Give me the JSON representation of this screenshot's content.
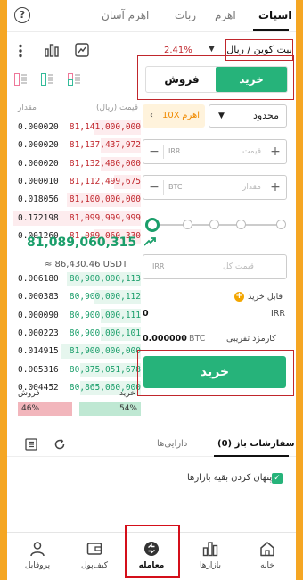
{
  "tabs": {
    "spot": "اسپات",
    "margin": "اهرم",
    "bot": "ربات",
    "easy_margin": "اهرم آسان"
  },
  "pair": {
    "name": "بیت کوین / ریال",
    "change": "2.41%"
  },
  "trade": {
    "buy_label": "خرید",
    "sell_label": "فروش",
    "order_type": "محدود",
    "leverage_label": "اهرم",
    "leverage_value": "10X"
  },
  "book": {
    "price_header": "قیمت (ریال)",
    "amount_header": "مقدار",
    "asks": [
      {
        "amount": "0.000020",
        "price": "81,141,000,000",
        "depth": 0.35
      },
      {
        "amount": "0.000020",
        "price": "81,137,437,972",
        "depth": 0.3
      },
      {
        "amount": "0.000020",
        "price": "81,132,480,000",
        "depth": 0.3
      },
      {
        "amount": "0.000010",
        "price": "81,112,499,675",
        "depth": 0.2
      },
      {
        "amount": "0.018056",
        "price": "81,100,000,000",
        "depth": 0.55
      },
      {
        "amount": "0.172198",
        "price": "81,099,999,999",
        "depth": 0.95
      },
      {
        "amount": "0.001260",
        "price": "81,089,060,330",
        "depth": 0.35
      }
    ],
    "last_price": "81,089,060,315",
    "usdt_price": "≈ 86,430.46 USDT",
    "bids": [
      {
        "amount": "0.006180",
        "price": "80,900,000,113",
        "depth": 0.55
      },
      {
        "amount": "0.000383",
        "price": "80,900,000,112",
        "depth": 0.35
      },
      {
        "amount": "0.000090",
        "price": "80,900,000,111",
        "depth": 0.3
      },
      {
        "amount": "0.000223",
        "price": "80,900,000,101",
        "depth": 0.3
      },
      {
        "amount": "0.014915",
        "price": "81,900,000,000",
        "depth": 0.6
      },
      {
        "amount": "0.005316",
        "price": "80,875,051,678",
        "depth": 0.45
      },
      {
        "amount": "0.004452",
        "price": "80,865,060,000",
        "depth": 0.45
      }
    ],
    "buy_ratio_label": "خرید",
    "sell_ratio_label": "فروش",
    "buy_ratio": "54%",
    "sell_ratio": "46%",
    "buy_ratio_value": 0.54,
    "sell_ratio_value": 0.46
  },
  "form": {
    "price_placeholder": "قیمت",
    "price_unit": "IRR",
    "amount_placeholder": "مقدار",
    "amount_unit": "BTC",
    "total_placeholder": "قیمت کل",
    "total_unit": "IRR",
    "available_label": "قابل خرید",
    "available_value": "0",
    "available_unit": "IRR",
    "fee_label": "کارمزد تقریبی",
    "fee_value": "0.000000",
    "fee_unit": "BTC",
    "submit_label": "خرید"
  },
  "orders": {
    "open_orders": "سفارشات باز (0)",
    "assets": "دارایی‌ها",
    "hide_other": "پنهان کردن بقیه بازارها"
  },
  "nav": {
    "home": "خانه",
    "markets": "بازارها",
    "trade": "معامله",
    "wallet": "کیف‌پول",
    "profile": "پروفایل"
  },
  "colors": {
    "buy": "#26b37a",
    "sell": "#c0262c",
    "accent": "#f5a623"
  }
}
